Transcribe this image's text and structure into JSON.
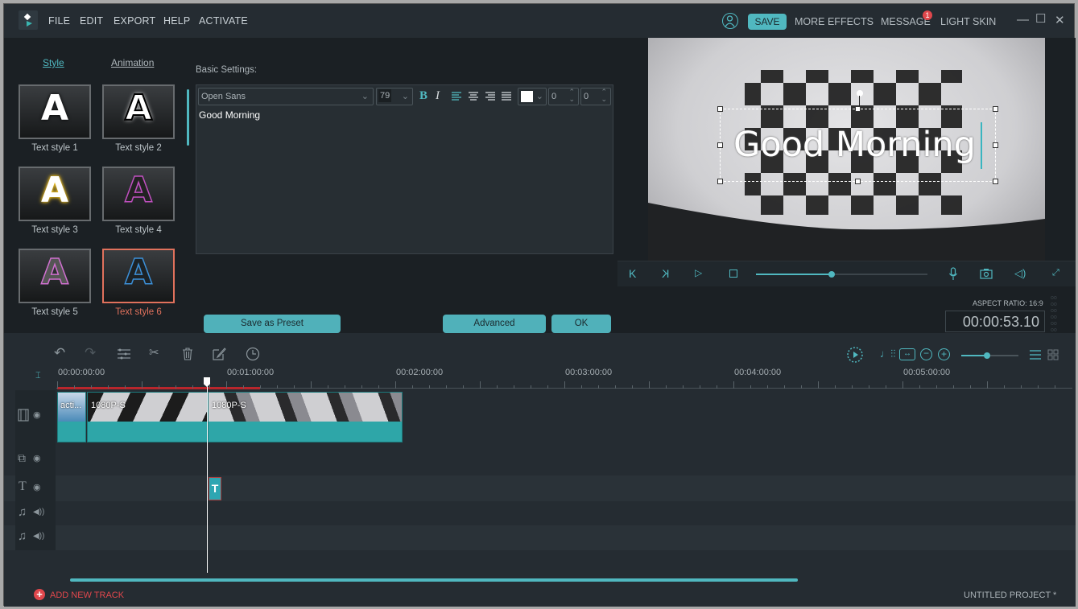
{
  "menubar": {
    "items": [
      "FILE",
      "EDIT",
      "EXPORT",
      "HELP",
      "ACTIVATE"
    ],
    "save": "SAVE",
    "more_effects": "MORE EFFECTS",
    "message": "MESSAGE",
    "message_badge": "1",
    "light_skin": "LIGHT SKIN",
    "minimize": "—",
    "maximize": "☐",
    "close": "✕"
  },
  "left_panel": {
    "tabs": [
      "Style",
      "Animation"
    ],
    "active_tab": "Style",
    "styles": [
      {
        "label": "Text style 1",
        "glyph": "A"
      },
      {
        "label": "Text style 2",
        "glyph": "A"
      },
      {
        "label": "Text style 3",
        "glyph": "A"
      },
      {
        "label": "Text style 4",
        "glyph": "A"
      },
      {
        "label": "Text style 5",
        "glyph": "A"
      },
      {
        "label": "Text style 6",
        "glyph": "A",
        "selected": true
      }
    ],
    "basic_settings_label": "Basic Settings:",
    "font": "Open Sans",
    "font_size": "79",
    "bold": "B",
    "italic": "I",
    "spacing_1": "0",
    "spacing_2": "0",
    "text_color": "#ffffff",
    "text_content": "Good Morning",
    "save_preset": "Save as Preset",
    "advanced": "Advanced",
    "ok": "OK"
  },
  "preview": {
    "overlay_text": "Good Morning",
    "playback_progress": 0.44,
    "aspect_ratio": "ASPECT RATIO: 16:9",
    "timecode": "00:00:53.10"
  },
  "timeline": {
    "ruler": [
      "00:00:00:00",
      "00:01:00:00",
      "00:02:00:00",
      "00:03:00:00",
      "00:04:00:00",
      "00:05:00:00"
    ],
    "zoom_level": 0.45,
    "clips": [
      {
        "label": "acti..."
      },
      {
        "label": "1080P-S"
      },
      {
        "label": "1080P-S"
      }
    ],
    "text_clip_label": "T",
    "add_track": "ADD NEW TRACK",
    "project_name": "UNTITLED PROJECT *"
  },
  "colors": {
    "accent": "#50b8c0",
    "selected": "#e0715c",
    "badge": "#e0474c"
  }
}
